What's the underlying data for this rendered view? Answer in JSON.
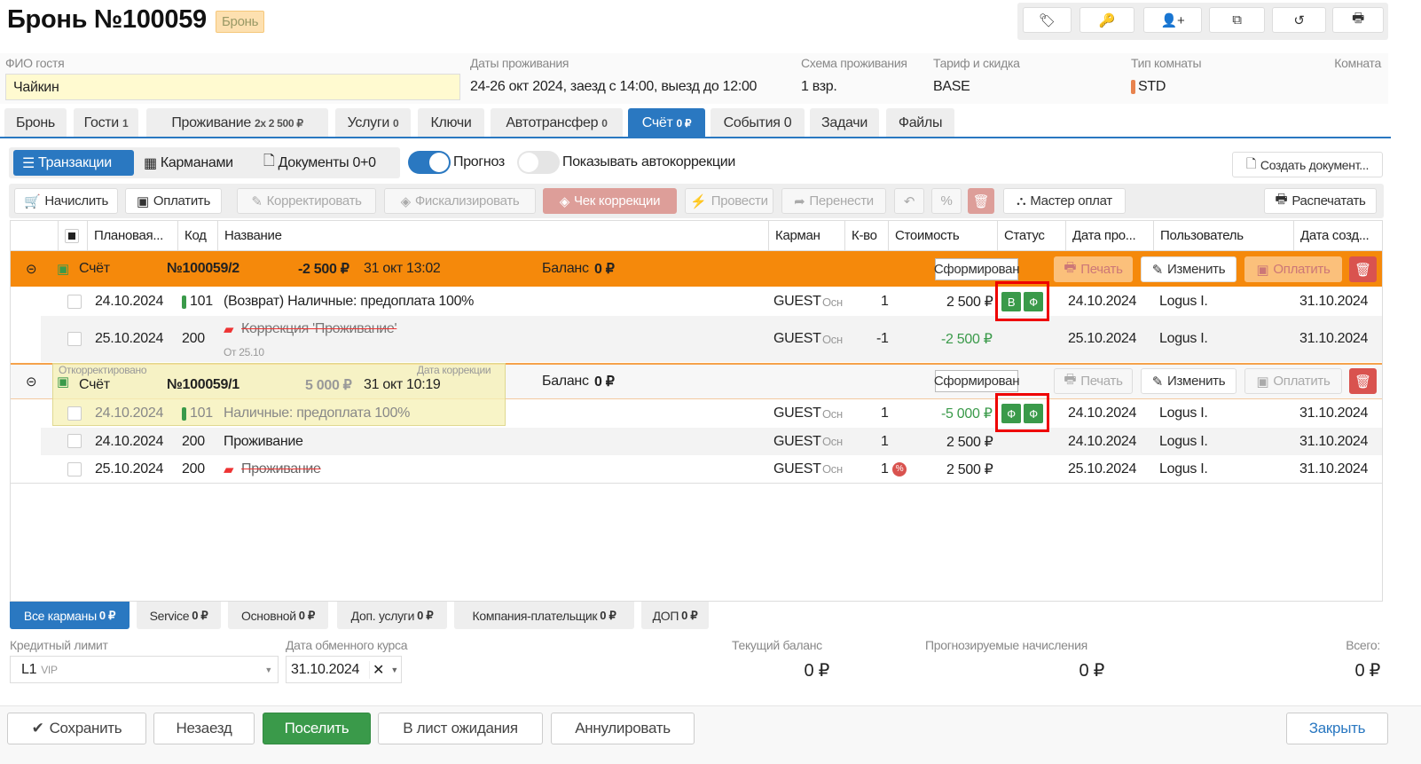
{
  "header": {
    "title": "Бронь №100059",
    "status_badge": "Бронь"
  },
  "top_toolbar": [
    "tag-icon",
    "key-icon",
    "add-user-icon",
    "copy-icon",
    "history-icon",
    "print-icon"
  ],
  "info": {
    "guest_label": "ФИО гостя",
    "guest_value": "Чайкин",
    "dates_label": "Даты проживания",
    "dates_value": "24-26 окт 2024, заезд с 14:00, выезд до 12:00",
    "scheme_label": "Схема проживания",
    "scheme_value": "1 взр.",
    "rate_label": "Тариф и скидка",
    "rate_value": "BASE",
    "room_type_label": "Тип комнаты",
    "room_type_value": "STD",
    "room_type_color": "#e8834e",
    "room_label": "Комната"
  },
  "tabs": [
    {
      "label": "Бронь",
      "count": ""
    },
    {
      "label": "Гости",
      "count": "1"
    },
    {
      "label": "Проживание",
      "count": "2x 2 500 ₽"
    },
    {
      "label": "Услуги",
      "count": "0"
    },
    {
      "label": "Ключи",
      "count": ""
    },
    {
      "label": "Автотрансфер",
      "count": "0"
    },
    {
      "label": "Счёт",
      "count": "0 ₽"
    },
    {
      "label": "События 0",
      "count": ""
    },
    {
      "label": "Задачи",
      "count": ""
    },
    {
      "label": "Файлы",
      "count": ""
    }
  ],
  "subtabs": {
    "transactions": "Транзакции",
    "pockets": "Карманами",
    "documents": "Документы 0+0",
    "forecast": "Прогноз",
    "forecast_on": true,
    "autocorr": "Показывать автокоррекции",
    "autocorr_on": false,
    "create_doc": "Создать документ..."
  },
  "actions": {
    "charge": "Начислить",
    "pay": "Оплатить",
    "correct": "Корректировать",
    "fiscalize": "Фискализировать",
    "corr_check": "Чек коррекции",
    "post": "Провести",
    "transfer": "Перенести",
    "payment_wizard": "Мастер оплат",
    "print": "Распечатать"
  },
  "columns": [
    "Плановая...",
    "Код",
    "Название",
    "Карман",
    "К-во",
    "Стоимость",
    "Статус",
    "Дата про...",
    "Пользователь",
    "Дата созд..."
  ],
  "groups": [
    {
      "type": "Счёт",
      "number": "№100059/2",
      "amount": "-2 500 ₽",
      "date": "31 окт 13:02",
      "balance_label": "Баланс",
      "balance": "0 ₽",
      "status": "Сформирован",
      "print": "Печать",
      "edit": "Изменить",
      "pay": "Оплатить",
      "rows": [
        {
          "date": "24.10.2024",
          "code": "101",
          "name": "(Возврат) Наличные: предоплата 100%",
          "pocket": "GUEST",
          "pocket_sub": "Осн",
          "qty": "1",
          "cost": "2 500 ₽",
          "badges": [
            "В",
            "Ф"
          ],
          "op_date": "24.10.2024",
          "user": "Logus I.",
          "created": "31.10.2024"
        },
        {
          "date": "25.10.2024",
          "code": "200",
          "name": "Коррекция 'Проживание'",
          "sub": "От 25.10",
          "pocket": "GUEST",
          "pocket_sub": "Осн",
          "qty": "-1",
          "cost": "-2 500 ₽",
          "op_date": "25.10.2024",
          "user": "Logus I.",
          "created": "31.10.2024"
        }
      ]
    },
    {
      "type": "Счёт",
      "number": "№100059/1",
      "amount": "5 000 ₽",
      "date": "31 окт 10:19",
      "balance_label": "Баланс",
      "balance": "0 ₽",
      "status": "Сформирован",
      "print": "Печать",
      "edit": "Изменить",
      "pay": "Оплатить",
      "tooltip_corrected": "Откорректировано",
      "tooltip_corr_date": "Дата коррекции",
      "rows": [
        {
          "date": "24.10.2024",
          "code": "101",
          "name": "Наличные: предоплата 100%",
          "pocket": "GUEST",
          "pocket_sub": "Осн",
          "qty": "1",
          "cost": "-5 000 ₽",
          "badges": [
            "Ф",
            "Ф"
          ],
          "op_date": "24.10.2024",
          "user": "Logus I.",
          "created": "31.10.2024"
        },
        {
          "date": "24.10.2024",
          "code": "200",
          "name": "Проживание",
          "pocket": "GUEST",
          "pocket_sub": "Осн",
          "qty": "1",
          "cost": "2 500 ₽",
          "op_date": "24.10.2024",
          "user": "Logus I.",
          "created": "31.10.2024"
        },
        {
          "date": "25.10.2024",
          "code": "200",
          "name": "Проживание",
          "pocket": "GUEST",
          "pocket_sub": "Осн",
          "qty": "1",
          "qty_badge": "%",
          "cost": "2 500 ₽",
          "op_date": "25.10.2024",
          "user": "Logus I.",
          "created": "31.10.2024"
        }
      ]
    }
  ],
  "pockets": [
    {
      "label": "Все карманы",
      "amount": "0 ₽"
    },
    {
      "label": "Service",
      "amount": "0 ₽"
    },
    {
      "label": "Основной",
      "amount": "0 ₽"
    },
    {
      "label": "Доп. услуги",
      "amount": "0 ₽"
    },
    {
      "label": "Компания-плательщик",
      "amount": "0 ₽"
    },
    {
      "label": "ДОП",
      "amount": "0 ₽"
    }
  ],
  "bottom": {
    "credit_label": "Кредитный лимит",
    "credit_value": "L1",
    "credit_sub": "VIP",
    "rate_date_label": "Дата обменного курса",
    "rate_date_value": "31.10.2024",
    "balance_label": "Текущий баланс",
    "balance_value": "0 ₽",
    "forecast_label": "Прогнозируемые начисления",
    "forecast_value": "0 ₽",
    "total_label": "Всего:",
    "total_value": "0 ₽"
  },
  "footer": {
    "save": "Сохранить",
    "noshow": "Незаезд",
    "checkin": "Поселить",
    "waitlist": "В лист ожидания",
    "cancel": "Аннулировать",
    "close": "Закрыть"
  },
  "colors": {
    "accent": "#2a78c1",
    "orange": "#f5890b",
    "green": "#3a9a4a",
    "danger": "#d9534f"
  }
}
